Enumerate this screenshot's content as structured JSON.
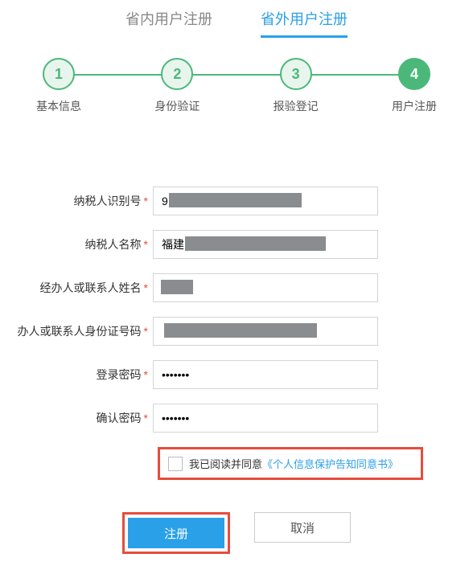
{
  "tabs": {
    "inProvince": "省内用户注册",
    "outProvince": "省外用户注册"
  },
  "steps": [
    {
      "num": "1",
      "label": "基本信息"
    },
    {
      "num": "2",
      "label": "身份验证"
    },
    {
      "num": "3",
      "label": "报验登记"
    },
    {
      "num": "4",
      "label": "用户注册"
    }
  ],
  "form": {
    "taxpayerId": {
      "label": "纳税人识别号",
      "value": "9"
    },
    "taxpayerName": {
      "label": "纳税人名称",
      "value": "福建"
    },
    "contactName": {
      "label": "经办人或联系人姓名",
      "value": ""
    },
    "contactIdNo": {
      "label": "办人或联系人身份证号码",
      "value": ""
    },
    "loginPwd": {
      "label": "登录密码",
      "value": "•••••••"
    },
    "confirmPwd": {
      "label": "确认密码",
      "value": "•••••••"
    }
  },
  "consent": {
    "prefix": "我已阅读并同意",
    "linkText": "《个人信息保护告知同意书》"
  },
  "buttons": {
    "submit": "注册",
    "cancel": "取消"
  }
}
